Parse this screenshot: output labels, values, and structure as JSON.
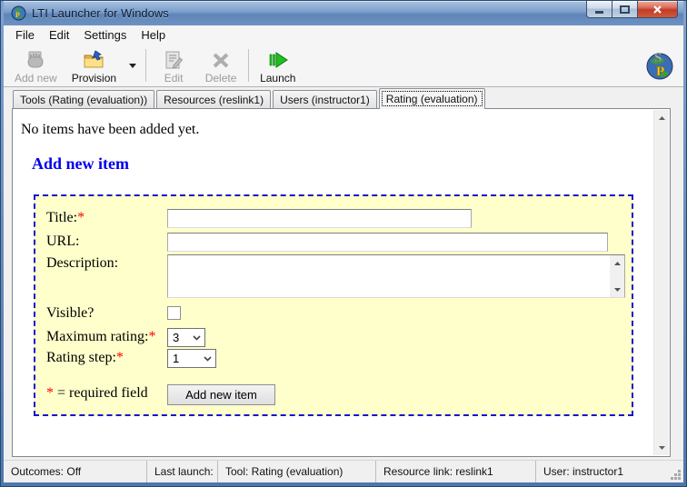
{
  "window": {
    "title": "LTI Launcher for Windows"
  },
  "menu": {
    "items": [
      {
        "label": "File"
      },
      {
        "label": "Edit"
      },
      {
        "label": "Settings"
      },
      {
        "label": "Help"
      }
    ]
  },
  "toolbar": {
    "buttons": [
      {
        "label": "Add new",
        "icon": "add-new-icon",
        "enabled": false
      },
      {
        "label": "Provision",
        "icon": "provision-icon",
        "enabled": true,
        "has_dropdown": true
      },
      {
        "label": "Edit",
        "icon": "edit-icon",
        "enabled": false
      },
      {
        "label": "Delete",
        "icon": "delete-icon",
        "enabled": false
      },
      {
        "label": "Launch",
        "icon": "launch-icon",
        "enabled": true
      }
    ],
    "logo": {
      "letters": "SP",
      "icon": "globe-sp-logo"
    }
  },
  "tabs": [
    {
      "label": "Tools (Rating (evaluation))",
      "active": false
    },
    {
      "label": "Resources (reslink1)",
      "active": false
    },
    {
      "label": "Users (instructor1)",
      "active": false
    },
    {
      "label": "Rating (evaluation)",
      "active": true
    }
  ],
  "content": {
    "empty_message": "No items have been added yet.",
    "heading": "Add new item",
    "form": {
      "title_label": "Title:",
      "title_value": "",
      "url_label": "URL:",
      "url_value": "",
      "description_label": "Description:",
      "description_value": "",
      "visible_label": "Visible?",
      "visible_checked": false,
      "max_rating_label": "Maximum rating:",
      "max_rating_value": "3",
      "rating_step_label": "Rating step:",
      "rating_step_value": "1",
      "required_marker": "*",
      "required_note": " = required field",
      "submit_label": "Add new item"
    }
  },
  "statusbar": {
    "panels": [
      {
        "text": "Outcomes: Off"
      },
      {
        "text": "Last launch:"
      },
      {
        "text": "Tool: Rating (evaluation)"
      },
      {
        "text": "Resource link: reslink1"
      },
      {
        "text": "User: instructor1"
      }
    ]
  },
  "colors": {
    "form_background": "#ffffcc",
    "form_border_blue": "#1414cc",
    "heading_blue": "#0000ee",
    "required_red": "#ff0000",
    "titlebar_blue": "#6e92c2",
    "launch_green": "#18a818"
  }
}
